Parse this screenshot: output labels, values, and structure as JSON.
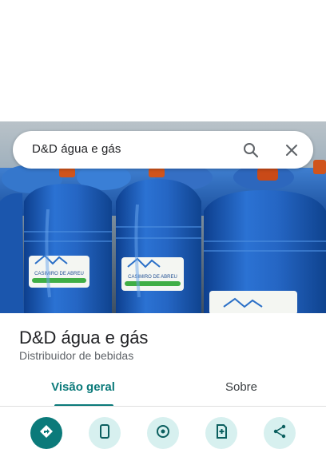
{
  "search": {
    "query": "D&D água e gás"
  },
  "place": {
    "name": "D&D água e gás",
    "category": "Distribuidor de bebidas"
  },
  "tabs": [
    {
      "label": "Visão geral",
      "active": true
    },
    {
      "label": "Sobre",
      "active": false
    }
  ],
  "photo": {
    "jug_label": "CASIMIRO DE ABREU"
  },
  "actions": [
    {
      "icon": "directions-icon"
    },
    {
      "icon": "phone-icon"
    },
    {
      "icon": "navigation-icon"
    },
    {
      "icon": "save-icon"
    },
    {
      "icon": "share-icon"
    }
  ],
  "colors": {
    "accent": "#0b7a7a",
    "action_bg": "#d7f0ef",
    "water_blue": "#1f5fb8"
  }
}
